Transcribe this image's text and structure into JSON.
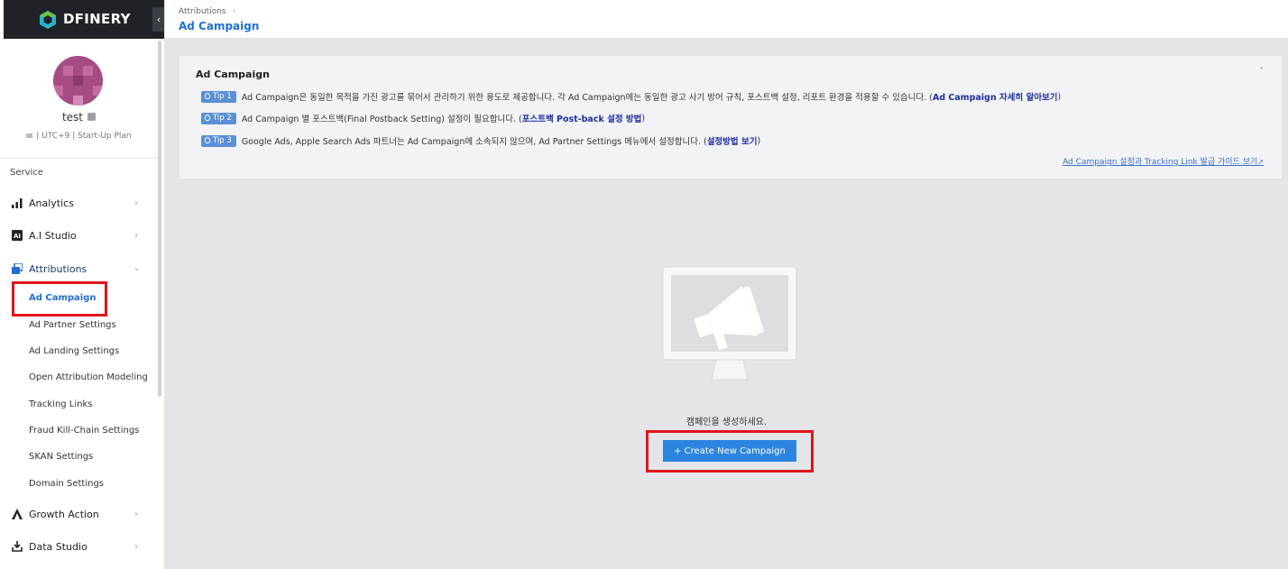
{
  "logo": {
    "text": "DFINERY"
  },
  "profile": {
    "name": "test",
    "meta": "| UTC+9 | Start-Up Plan"
  },
  "sidebar": {
    "section": "Service",
    "items": [
      {
        "label": "Analytics",
        "icon": "bar-chart-icon"
      },
      {
        "label": "A.I Studio",
        "icon": "ai-icon"
      },
      {
        "label": "Attributions",
        "icon": "attributions-icon"
      },
      {
        "label": "Growth Action",
        "icon": "growth-icon"
      },
      {
        "label": "Data Studio",
        "icon": "download-icon"
      }
    ],
    "sub_items": [
      {
        "label": "Ad Campaign"
      },
      {
        "label": "Ad Partner Settings"
      },
      {
        "label": "Ad Landing Settings"
      },
      {
        "label": "Open Attribution Modeling"
      },
      {
        "label": "Tracking Links"
      },
      {
        "label": "Fraud Kill-Chain Settings"
      },
      {
        "label": "SKAN Settings"
      },
      {
        "label": "Domain Settings"
      }
    ]
  },
  "header": {
    "breadcrumb": "Attributions",
    "title": "Ad Campaign"
  },
  "info": {
    "title": "Ad Campaign",
    "tips": [
      {
        "badge": "Tip 1",
        "text": "Ad Campaign은 동일한 목적을 가진 광고를 묶어서 관리하기 위한 용도로 제공합니다. 각 Ad Campaign에는 동일한 광고 사기 방어 규칙, 포스트백 설정, 리포트 환경을 적용할 수 있습니다. (",
        "link": "Ad Campaign 자세히 알아보기",
        "suffix": ")"
      },
      {
        "badge": "Tip 2",
        "text": "Ad Campaign 별 포스트백(Final Postback Setting) 설정이 필요합니다. (",
        "link": "포스트백 Post-back 설정 방법",
        "suffix": ")"
      },
      {
        "badge": "Tip 3",
        "text": "Google Ads, Apple Search Ads 파트너는 Ad Campaign에 소속되지 않으며, Ad Partner Settings 메뉴에서 설정합니다. (",
        "link": "설정방법 보기",
        "suffix": ")"
      }
    ],
    "guide_link": "Ad Campaign 설정과 Tracking Link 발급 가이드 보기"
  },
  "empty_state": {
    "message": "캠페인을 생성하세요.",
    "button": "+ Create New Campaign"
  }
}
